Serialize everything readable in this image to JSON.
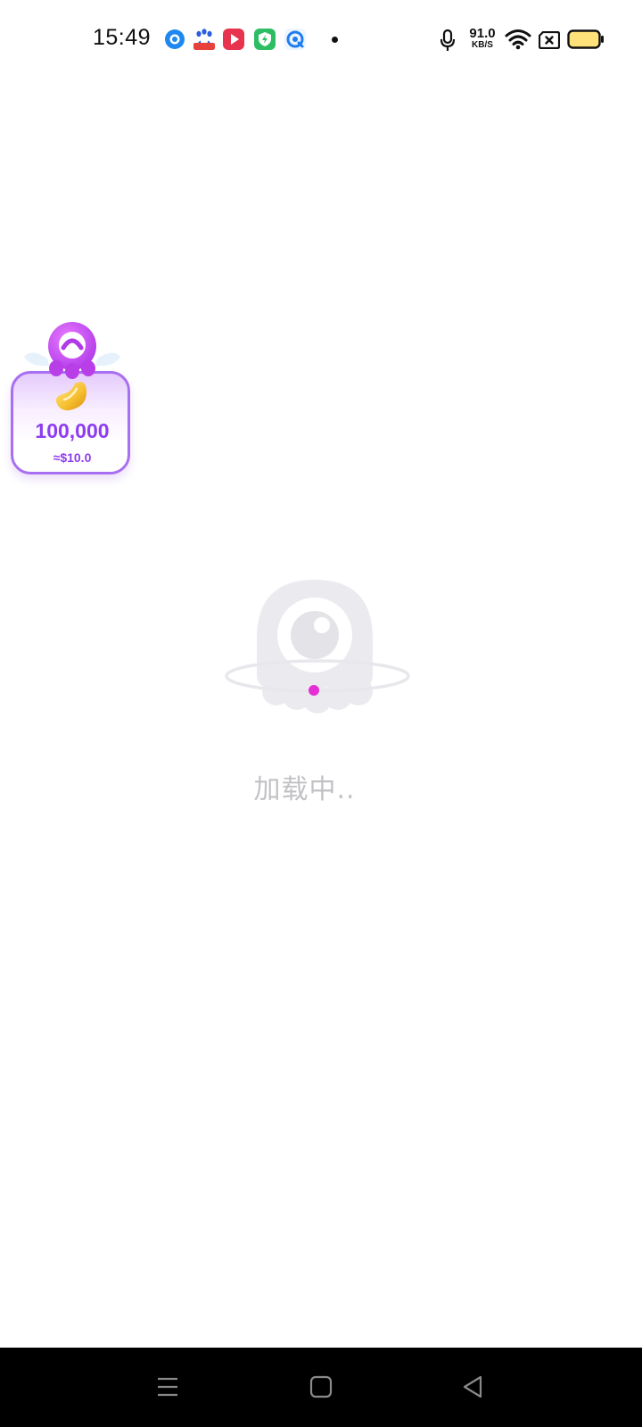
{
  "status_bar": {
    "time": "15:49",
    "network_speed_value": "91.0",
    "network_speed_unit": "KB/S",
    "notification_icons": [
      "blue-ring-app-icon",
      "baidu-icon",
      "red-video-app-icon",
      "green-shield-app-icon",
      "blue-circle-app-icon"
    ],
    "system_icons": [
      "microphone-icon",
      "wifi-icon",
      "no-sim-icon",
      "battery-icon"
    ]
  },
  "reward_widget": {
    "amount": "100,000",
    "usd_equivalent": "≈$10.0",
    "icons": [
      "octopus-mascot-icon",
      "golden-bean-coin-icon"
    ],
    "accent_color": "#8d3cf0"
  },
  "loading": {
    "text": "加载中..",
    "icon": "octopus-planet-loader-icon",
    "dot_color": "#e52fd5"
  },
  "nav_bar": {
    "buttons": [
      "menu-icon",
      "home-icon",
      "back-icon"
    ]
  }
}
